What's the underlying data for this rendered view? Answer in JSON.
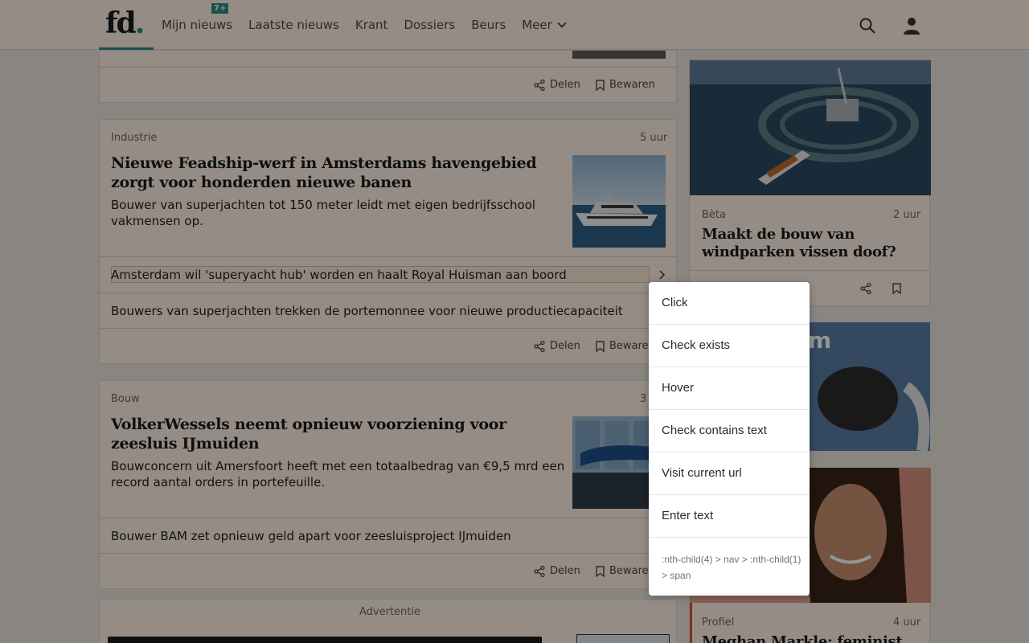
{
  "header": {
    "logo_text": "fd",
    "logo_dot": ".",
    "nav": [
      {
        "label": "Mijn nieuws",
        "badge": "7+"
      },
      {
        "label": "Laatste nieuws"
      },
      {
        "label": "Krant"
      },
      {
        "label": "Dossiers"
      },
      {
        "label": "Beurs"
      },
      {
        "label": "Meer"
      }
    ],
    "icons": [
      "search-icon",
      "user-icon"
    ]
  },
  "main": {
    "top_card": {
      "share": "Delen",
      "save": "Bewaren"
    },
    "article1": {
      "topic": "Industrie",
      "time": "5 uur",
      "headline": "Nieuwe Feadship-werf in Amsterdams havengebied zorgt voor honderden nieuwe banen",
      "lead": "Bouwer van superjachten tot 150 meter leidt met eigen bedrijfsschool vakmensen op.",
      "related": [
        "Amsterdam wil 'superyacht hub' worden en haalt Royal Huisman aan boord",
        "Bouwers van superjachten trekken de portemonnee voor nieuwe productiecapaciteit"
      ],
      "share": "Delen",
      "save": "Bewaren"
    },
    "article2": {
      "topic": "Bouw",
      "time": "3",
      "headline": "VolkerWessels neemt opnieuw voorziening voor zeesluis IJmuiden",
      "lead": "Bouwconcern uit Amersfoort heeft met een totaalbedrag van €9,5 mrd een record aantal orders in portefeuille.",
      "related": [
        "Bouwer BAM zet opnieuw geld apart voor zeesluisproject IJmuiden"
      ],
      "share": "Delen",
      "save": "Bewaren"
    },
    "ad_label": "Advertentie"
  },
  "sidebar": {
    "article1": {
      "topic": "Bèta",
      "time": "2 uur",
      "headline": "Maakt de bouw van windparken vissen doof?"
    },
    "ad_text": "m",
    "article2": {
      "topic": "Profiel",
      "time": "4 uur",
      "headline": "Meghan Markle: feminist"
    }
  },
  "context_menu": {
    "items": [
      "Click",
      "Check exists",
      "Hover",
      "Check contains text",
      "Visit current url",
      "Enter text"
    ],
    "selector": ":nth-child(4) > nav > :nth-child(1) > span"
  },
  "colors": {
    "accent": "#2b8a87",
    "page_bg": "#fff1e6",
    "overlay": "rgba(0,0,0,0.42)"
  }
}
